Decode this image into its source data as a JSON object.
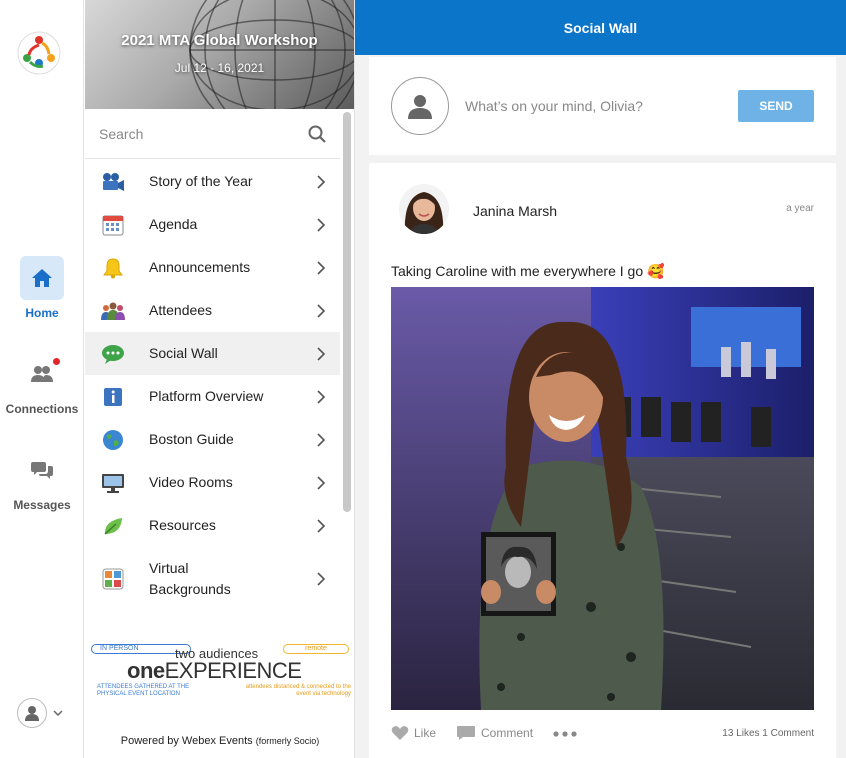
{
  "rail": {
    "logo": "people-circle-logo",
    "items": [
      {
        "label": "Home",
        "icon": "home-icon",
        "active": true
      },
      {
        "label": "Connections",
        "icon": "people-icon",
        "badge": true
      },
      {
        "label": "Messages",
        "icon": "chat-bubbles-icon"
      }
    ]
  },
  "event": {
    "title": "2021 MTA Global Workshop",
    "dates": "Jul 12 - 16, 2021"
  },
  "search": {
    "placeholder": "Search"
  },
  "menu": [
    {
      "label": "Story of the Year",
      "icon": "video-camera-icon"
    },
    {
      "label": "Agenda",
      "icon": "calendar-icon"
    },
    {
      "label": "Announcements",
      "icon": "bell-icon"
    },
    {
      "label": "Attendees",
      "icon": "attendees-icon"
    },
    {
      "label": "Social Wall",
      "icon": "speech-bubble-icon",
      "active": true
    },
    {
      "label": "Platform Overview",
      "icon": "info-icon"
    },
    {
      "label": "Boston Guide",
      "icon": "globe-icon"
    },
    {
      "label": "Video Rooms",
      "icon": "monitor-icon"
    },
    {
      "label": "Resources",
      "icon": "leaf-icon"
    },
    {
      "label": "Virtual Backgrounds",
      "label_line1": "Virtual",
      "label_line2": "Backgrounds",
      "icon": "photo-grid-icon"
    }
  ],
  "promo": {
    "in_person": "IN PERSON",
    "remote": "remote",
    "two": "two audiences",
    "one": "one",
    "experience": "EXPERIENCE",
    "sub_left": "ATTENDEES GATHERED AT THE PHYSICAL EVENT LOCATION",
    "sub_right": "attendees distanced & connected to the event via technology"
  },
  "powered": {
    "text": "Powered by Webex Events",
    "note": "(formerly Socio)"
  },
  "main": {
    "title": "Social Wall",
    "composer": {
      "placeholder": "What’s on your mind, Olivia?",
      "send": "SEND"
    },
    "post": {
      "author": "Janina Marsh",
      "time": "a year",
      "text": "Taking Caroline with me everywhere I go 🥰",
      "like": "Like",
      "comment": "Comment",
      "counts": "13 Likes  1 Comment"
    }
  },
  "colors": {
    "accent": "#0b75c9",
    "send": "#6fb3e6",
    "badge": "#e3242b"
  }
}
